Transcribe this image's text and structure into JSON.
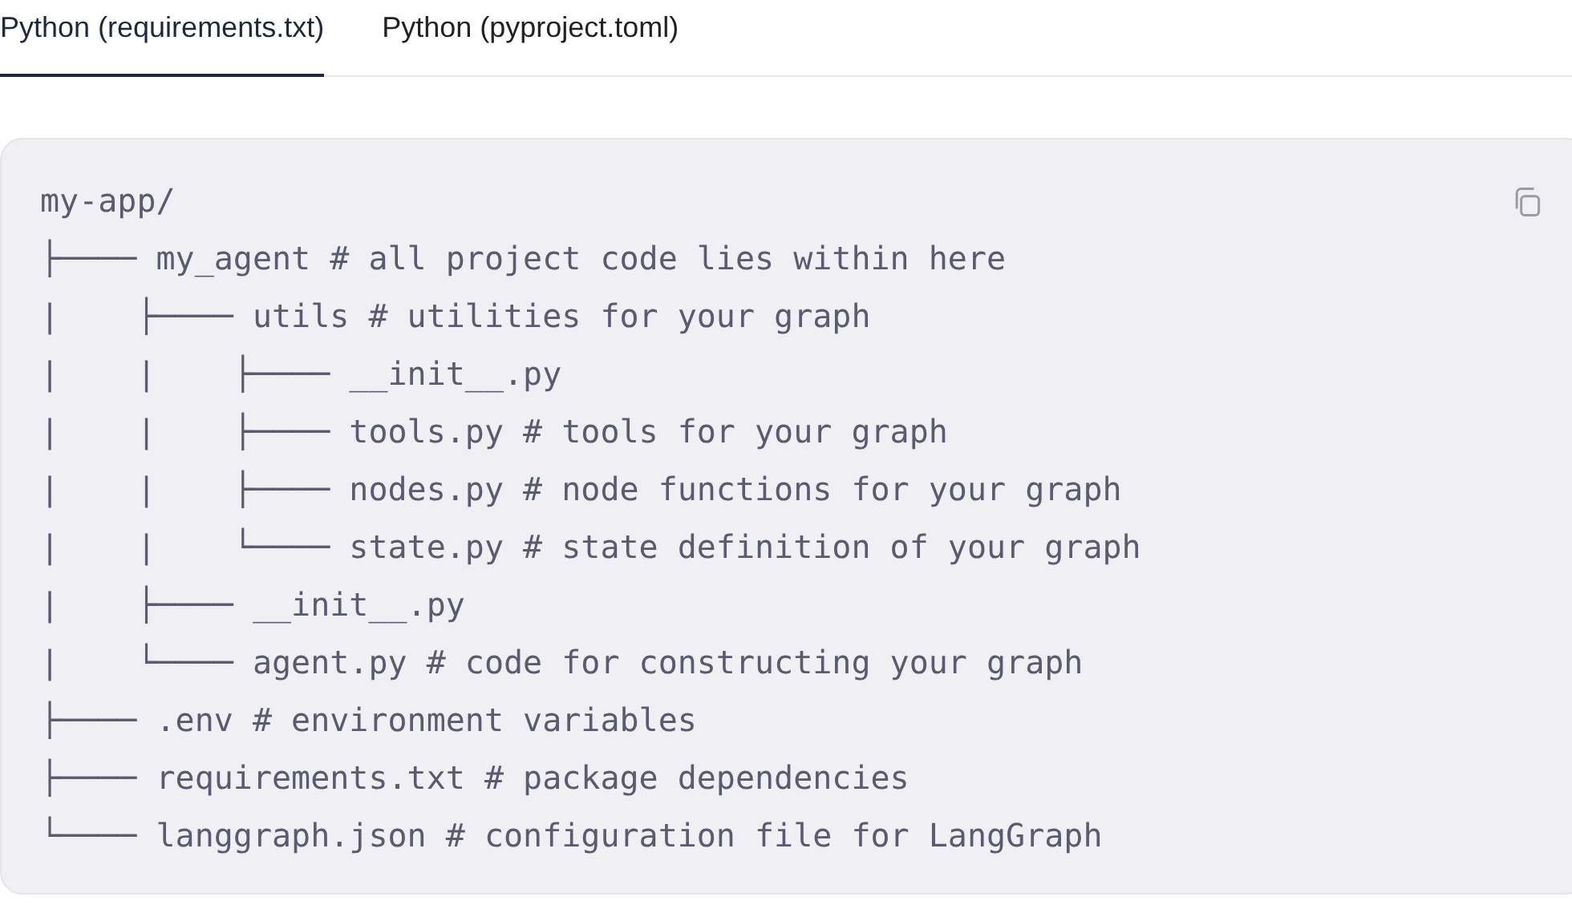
{
  "tabs": [
    {
      "label": "Python (requirements.txt)",
      "selected": true
    },
    {
      "label": "Python (pyproject.toml)",
      "selected": false
    }
  ],
  "code_block": {
    "lines": [
      "my-app/",
      "├──── my_agent # all project code lies within here",
      "|    ├──── utils # utilities for your graph",
      "|    |    ├──── __init__.py",
      "|    |    ├──── tools.py # tools for your graph",
      "|    |    ├──── nodes.py # node functions for your graph",
      "|    |    └──── state.py # state definition of your graph",
      "|    ├──── __init__.py",
      "|    └──── agent.py # code for constructing your graph",
      "├──── .env # environment variables",
      "├──── requirements.txt # package dependencies",
      "└──── langgraph.json # configuration file for LangGraph"
    ]
  }
}
